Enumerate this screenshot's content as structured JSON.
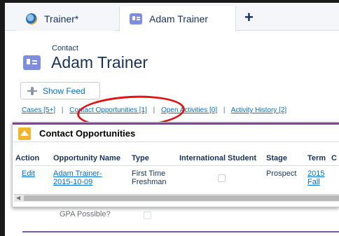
{
  "tabs": [
    {
      "label": "Trainer*",
      "icon": "trainer-icon",
      "active": false
    },
    {
      "label": "Adam Trainer",
      "icon": "contact-icon",
      "active": true
    }
  ],
  "new_tab_symbol": "+",
  "header": {
    "object_label": "Contact",
    "record_name": "Adam Trainer"
  },
  "show_feed_label": "Show Feed",
  "related_links": {
    "cases": "Cases [5+]",
    "contact_opportunities": "Contact Opportunities [1]",
    "open_activities": "Open Activities [0]",
    "activity_history": "Activity History [2]",
    "separator": "|"
  },
  "popup": {
    "title": "Contact Opportunities",
    "columns": [
      "Action",
      "Opportunity Name",
      "Type",
      "International Student",
      "Stage",
      "Term",
      "C"
    ],
    "rows": [
      {
        "action": "Edit",
        "opportunity_name_line1": "Adam Trainer-",
        "opportunity_name_line2": "2015-10-09",
        "type_line1": "First Time",
        "type_line2": "Freshman",
        "international_student": false,
        "stage": "Prospect",
        "term_line1": "2015",
        "term_line2": "Fall"
      }
    ]
  },
  "background_field_label": "GPA Possible?",
  "colors": {
    "link": "#0070d2",
    "highlight_oval": "#e01414",
    "popup_accent": "#8a3fa0",
    "crown_icon": "#f2b42b",
    "contact_icon": "#7f8de1"
  }
}
